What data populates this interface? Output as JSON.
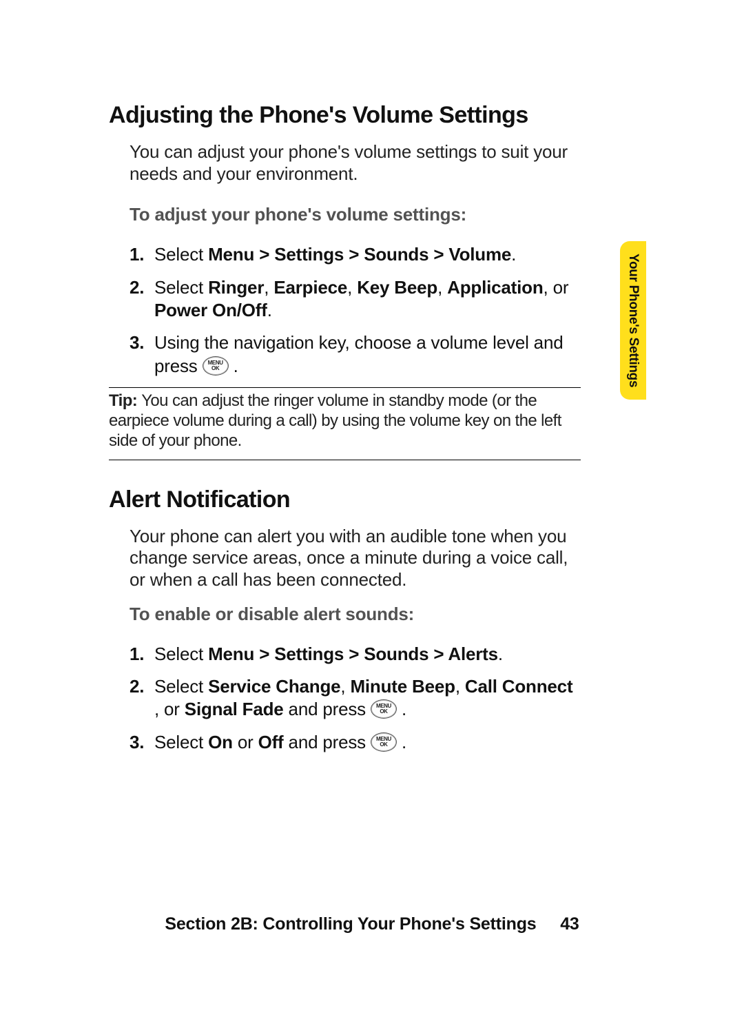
{
  "headings": {
    "h1": "Adjusting the Phone's Volume Settings",
    "h2": "Alert Notification"
  },
  "intros": {
    "vol": "You can adjust your phone's volume settings to suit your needs and your environment.",
    "alert": "Your phone can alert you with an audible tone when you change service areas, once a minute during a voice call, or when a call has been connected."
  },
  "subheads": {
    "vol": "To adjust your phone's volume settings:",
    "alert": "To enable or disable alert sounds:"
  },
  "vol_steps": {
    "n1": "1.",
    "s1a": "Select ",
    "s1b": "Menu > Settings > Sounds > Volume",
    "s1c": ".",
    "n2": "2.",
    "s2a": "Select ",
    "s2b": "Ringer",
    "s2c": ", ",
    "s2d": "Earpiece",
    "s2e": ", ",
    "s2f": "Key Beep",
    "s2g": ", ",
    "s2h": "Application",
    "s2i": ", or ",
    "s2j": "Power On/Off",
    "s2k": ".",
    "n3": "3.",
    "s3a": "Using the navigation key, choose a volume level and press ",
    "s3b": " ."
  },
  "tip": {
    "label": "Tip: ",
    "text": "You can adjust the ringer volume in standby mode (or the earpiece volume during a call) by using the volume key on the left side of your phone."
  },
  "alert_steps": {
    "n1": "1.",
    "s1a": "Select ",
    "s1b": "Menu > Settings > Sounds > Alerts",
    "s1c": ".",
    "n2": "2.",
    "s2a": "Select ",
    "s2b": "Service Change",
    "s2c": ", ",
    "s2d": "Minute Beep",
    "s2e": ", ",
    "s2f": "Call Connect",
    "s2g": " , or ",
    "s2h": "Signal Fade",
    "s2i": " and press ",
    "s2j": " .",
    "n3": "3.",
    "s3a": "Select ",
    "s3b": "On",
    "s3c": " or ",
    "s3d": "Off",
    "s3e": " and press ",
    "s3f": " ."
  },
  "menu_key": {
    "line1": "MENU",
    "line2": "OK"
  },
  "side_tab": "Your Phone's Settings",
  "footer": {
    "text": "Section 2B: Controlling Your Phone's Settings",
    "page": "43"
  }
}
